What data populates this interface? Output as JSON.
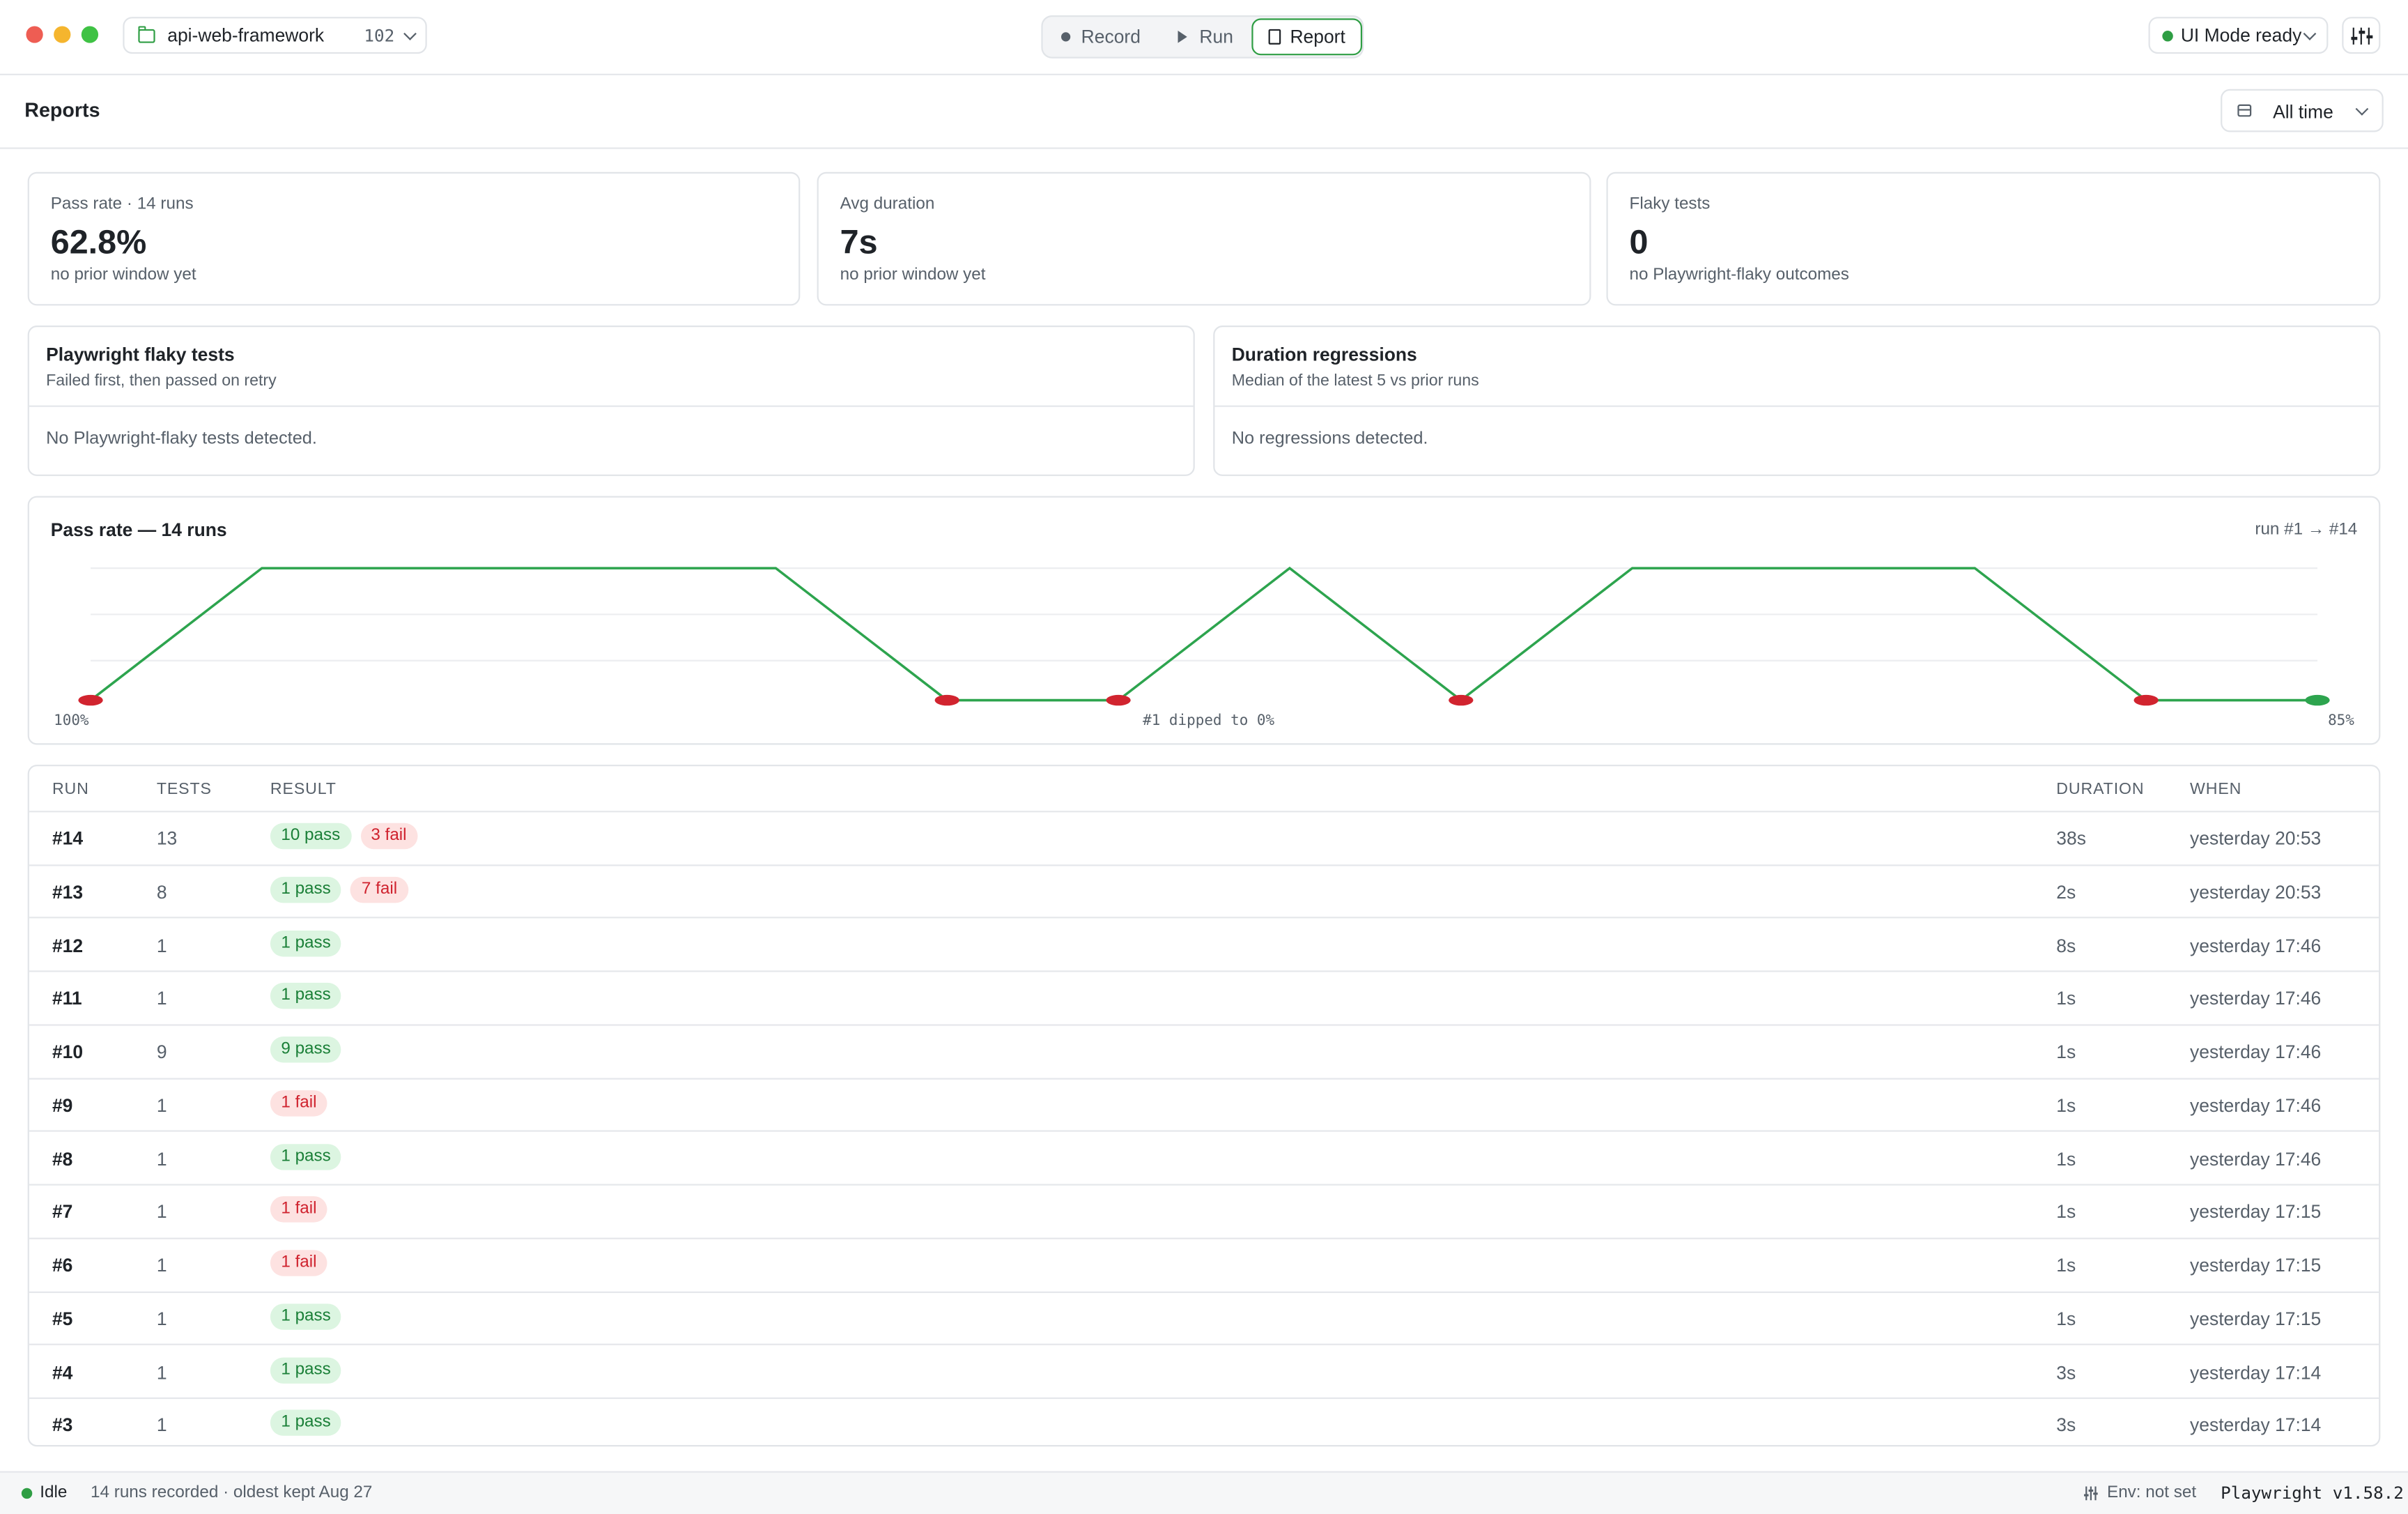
{
  "titlebar": {
    "project_name": "api-web-framework",
    "project_count": "102",
    "modes": {
      "record": "Record",
      "run": "Run",
      "report": "Report"
    },
    "status": "UI Mode ready"
  },
  "reports": {
    "title": "Reports",
    "time_filter": "All time"
  },
  "stats": [
    {
      "label": "Pass rate · 14 runs",
      "value": "62.8%",
      "sub": "no prior window yet"
    },
    {
      "label": "Avg duration",
      "value": "7s",
      "sub": "no prior window yet"
    },
    {
      "label": "Flaky tests",
      "value": "0",
      "sub": "no Playwright-flaky outcomes"
    }
  ],
  "panels": [
    {
      "title": "Playwright flaky tests",
      "sub": "Failed first, then passed on retry",
      "empty": "No Playwright-flaky tests detected."
    },
    {
      "title": "Duration regressions",
      "sub": "Median of the latest 5 vs prior runs",
      "empty": "No regressions detected."
    }
  ],
  "chart_data": {
    "type": "line",
    "title": "Pass rate — 14 runs",
    "range_label": "run #1 → #14",
    "x": [
      1,
      2,
      3,
      4,
      5,
      6,
      7,
      8,
      9,
      10,
      11,
      12,
      13,
      14
    ],
    "values": [
      0,
      100,
      100,
      100,
      100,
      0,
      0,
      100,
      0,
      100,
      100,
      100,
      0,
      0
    ],
    "ylim": [
      0,
      100
    ],
    "point_colors": {
      "fail": "#d1242f",
      "last": "#2da44e"
    },
    "line_color": "#2da44e",
    "annotations": {
      "left": "100%",
      "center": "#1 dipped to 0%",
      "right": "85%"
    }
  },
  "table": {
    "headers": {
      "run": "RUN",
      "tests": "TESTS",
      "result": "RESULT",
      "duration": "DURATION",
      "when": "WHEN"
    },
    "rows": [
      {
        "run": "#14",
        "tests": "13",
        "pass": "10 pass",
        "fail": "3 fail",
        "duration": "38s",
        "when": "yesterday 20:53"
      },
      {
        "run": "#13",
        "tests": "8",
        "pass": "1 pass",
        "fail": "7 fail",
        "duration": "2s",
        "when": "yesterday 20:53"
      },
      {
        "run": "#12",
        "tests": "1",
        "pass": "1 pass",
        "fail": "",
        "duration": "8s",
        "when": "yesterday 17:46"
      },
      {
        "run": "#11",
        "tests": "1",
        "pass": "1 pass",
        "fail": "",
        "duration": "1s",
        "when": "yesterday 17:46"
      },
      {
        "run": "#10",
        "tests": "9",
        "pass": "9 pass",
        "fail": "",
        "duration": "1s",
        "when": "yesterday 17:46"
      },
      {
        "run": "#9",
        "tests": "1",
        "pass": "",
        "fail": "1 fail",
        "duration": "1s",
        "when": "yesterday 17:46"
      },
      {
        "run": "#8",
        "tests": "1",
        "pass": "1 pass",
        "fail": "",
        "duration": "1s",
        "when": "yesterday 17:46"
      },
      {
        "run": "#7",
        "tests": "1",
        "pass": "",
        "fail": "1 fail",
        "duration": "1s",
        "when": "yesterday 17:15"
      },
      {
        "run": "#6",
        "tests": "1",
        "pass": "",
        "fail": "1 fail",
        "duration": "1s",
        "when": "yesterday 17:15"
      },
      {
        "run": "#5",
        "tests": "1",
        "pass": "1 pass",
        "fail": "",
        "duration": "1s",
        "when": "yesterday 17:15"
      },
      {
        "run": "#4",
        "tests": "1",
        "pass": "1 pass",
        "fail": "",
        "duration": "3s",
        "when": "yesterday 17:14"
      },
      {
        "run": "#3",
        "tests": "1",
        "pass": "1 pass",
        "fail": "",
        "duration": "3s",
        "when": "yesterday 17:14"
      }
    ]
  },
  "statusbar": {
    "state": "Idle",
    "message": "14 runs recorded · oldest kept Aug 27",
    "env": "Env: not set",
    "version": "Playwright v1.58.2"
  }
}
